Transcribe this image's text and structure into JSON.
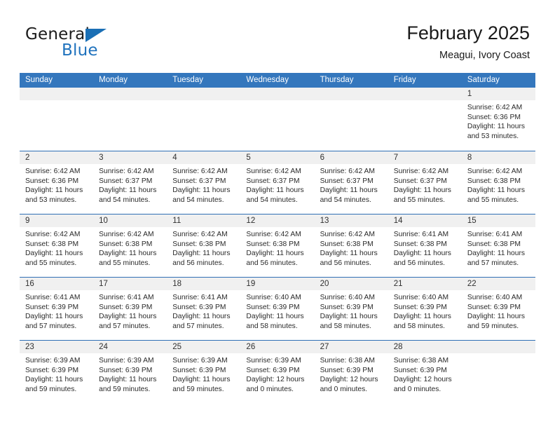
{
  "brand": {
    "word1": "General",
    "word2": "Blue",
    "logo_icon": "blue-triangle-logo"
  },
  "header": {
    "title": "February 2025",
    "subtitle": "Meagui, Ivory Coast"
  },
  "colors": {
    "header_blue": "#3477bd",
    "row_divider_blue": "#2f6fb5",
    "daynum_band": "#f0f0f0",
    "brand_blue": "#1f72bd",
    "text": "#1a1a1a"
  },
  "calendar": {
    "weekday_headers": [
      "Sunday",
      "Monday",
      "Tuesday",
      "Wednesday",
      "Thursday",
      "Friday",
      "Saturday"
    ],
    "weeks": [
      [
        {
          "day": "",
          "lines": []
        },
        {
          "day": "",
          "lines": []
        },
        {
          "day": "",
          "lines": []
        },
        {
          "day": "",
          "lines": []
        },
        {
          "day": "",
          "lines": []
        },
        {
          "day": "",
          "lines": []
        },
        {
          "day": "1",
          "lines": [
            "Sunrise: 6:42 AM",
            "Sunset: 6:36 PM",
            "Daylight: 11 hours and 53 minutes."
          ]
        }
      ],
      [
        {
          "day": "2",
          "lines": [
            "Sunrise: 6:42 AM",
            "Sunset: 6:36 PM",
            "Daylight: 11 hours and 53 minutes."
          ]
        },
        {
          "day": "3",
          "lines": [
            "Sunrise: 6:42 AM",
            "Sunset: 6:37 PM",
            "Daylight: 11 hours and 54 minutes."
          ]
        },
        {
          "day": "4",
          "lines": [
            "Sunrise: 6:42 AM",
            "Sunset: 6:37 PM",
            "Daylight: 11 hours and 54 minutes."
          ]
        },
        {
          "day": "5",
          "lines": [
            "Sunrise: 6:42 AM",
            "Sunset: 6:37 PM",
            "Daylight: 11 hours and 54 minutes."
          ]
        },
        {
          "day": "6",
          "lines": [
            "Sunrise: 6:42 AM",
            "Sunset: 6:37 PM",
            "Daylight: 11 hours and 54 minutes."
          ]
        },
        {
          "day": "7",
          "lines": [
            "Sunrise: 6:42 AM",
            "Sunset: 6:37 PM",
            "Daylight: 11 hours and 55 minutes."
          ]
        },
        {
          "day": "8",
          "lines": [
            "Sunrise: 6:42 AM",
            "Sunset: 6:38 PM",
            "Daylight: 11 hours and 55 minutes."
          ]
        }
      ],
      [
        {
          "day": "9",
          "lines": [
            "Sunrise: 6:42 AM",
            "Sunset: 6:38 PM",
            "Daylight: 11 hours and 55 minutes."
          ]
        },
        {
          "day": "10",
          "lines": [
            "Sunrise: 6:42 AM",
            "Sunset: 6:38 PM",
            "Daylight: 11 hours and 55 minutes."
          ]
        },
        {
          "day": "11",
          "lines": [
            "Sunrise: 6:42 AM",
            "Sunset: 6:38 PM",
            "Daylight: 11 hours and 56 minutes."
          ]
        },
        {
          "day": "12",
          "lines": [
            "Sunrise: 6:42 AM",
            "Sunset: 6:38 PM",
            "Daylight: 11 hours and 56 minutes."
          ]
        },
        {
          "day": "13",
          "lines": [
            "Sunrise: 6:42 AM",
            "Sunset: 6:38 PM",
            "Daylight: 11 hours and 56 minutes."
          ]
        },
        {
          "day": "14",
          "lines": [
            "Sunrise: 6:41 AM",
            "Sunset: 6:38 PM",
            "Daylight: 11 hours and 56 minutes."
          ]
        },
        {
          "day": "15",
          "lines": [
            "Sunrise: 6:41 AM",
            "Sunset: 6:38 PM",
            "Daylight: 11 hours and 57 minutes."
          ]
        }
      ],
      [
        {
          "day": "16",
          "lines": [
            "Sunrise: 6:41 AM",
            "Sunset: 6:39 PM",
            "Daylight: 11 hours and 57 minutes."
          ]
        },
        {
          "day": "17",
          "lines": [
            "Sunrise: 6:41 AM",
            "Sunset: 6:39 PM",
            "Daylight: 11 hours and 57 minutes."
          ]
        },
        {
          "day": "18",
          "lines": [
            "Sunrise: 6:41 AM",
            "Sunset: 6:39 PM",
            "Daylight: 11 hours and 57 minutes."
          ]
        },
        {
          "day": "19",
          "lines": [
            "Sunrise: 6:40 AM",
            "Sunset: 6:39 PM",
            "Daylight: 11 hours and 58 minutes."
          ]
        },
        {
          "day": "20",
          "lines": [
            "Sunrise: 6:40 AM",
            "Sunset: 6:39 PM",
            "Daylight: 11 hours and 58 minutes."
          ]
        },
        {
          "day": "21",
          "lines": [
            "Sunrise: 6:40 AM",
            "Sunset: 6:39 PM",
            "Daylight: 11 hours and 58 minutes."
          ]
        },
        {
          "day": "22",
          "lines": [
            "Sunrise: 6:40 AM",
            "Sunset: 6:39 PM",
            "Daylight: 11 hours and 59 minutes."
          ]
        }
      ],
      [
        {
          "day": "23",
          "lines": [
            "Sunrise: 6:39 AM",
            "Sunset: 6:39 PM",
            "Daylight: 11 hours and 59 minutes."
          ]
        },
        {
          "day": "24",
          "lines": [
            "Sunrise: 6:39 AM",
            "Sunset: 6:39 PM",
            "Daylight: 11 hours and 59 minutes."
          ]
        },
        {
          "day": "25",
          "lines": [
            "Sunrise: 6:39 AM",
            "Sunset: 6:39 PM",
            "Daylight: 11 hours and 59 minutes."
          ]
        },
        {
          "day": "26",
          "lines": [
            "Sunrise: 6:39 AM",
            "Sunset: 6:39 PM",
            "Daylight: 12 hours and 0 minutes."
          ]
        },
        {
          "day": "27",
          "lines": [
            "Sunrise: 6:38 AM",
            "Sunset: 6:39 PM",
            "Daylight: 12 hours and 0 minutes."
          ]
        },
        {
          "day": "28",
          "lines": [
            "Sunrise: 6:38 AM",
            "Sunset: 6:39 PM",
            "Daylight: 12 hours and 0 minutes."
          ]
        },
        {
          "day": "",
          "lines": []
        }
      ]
    ]
  }
}
